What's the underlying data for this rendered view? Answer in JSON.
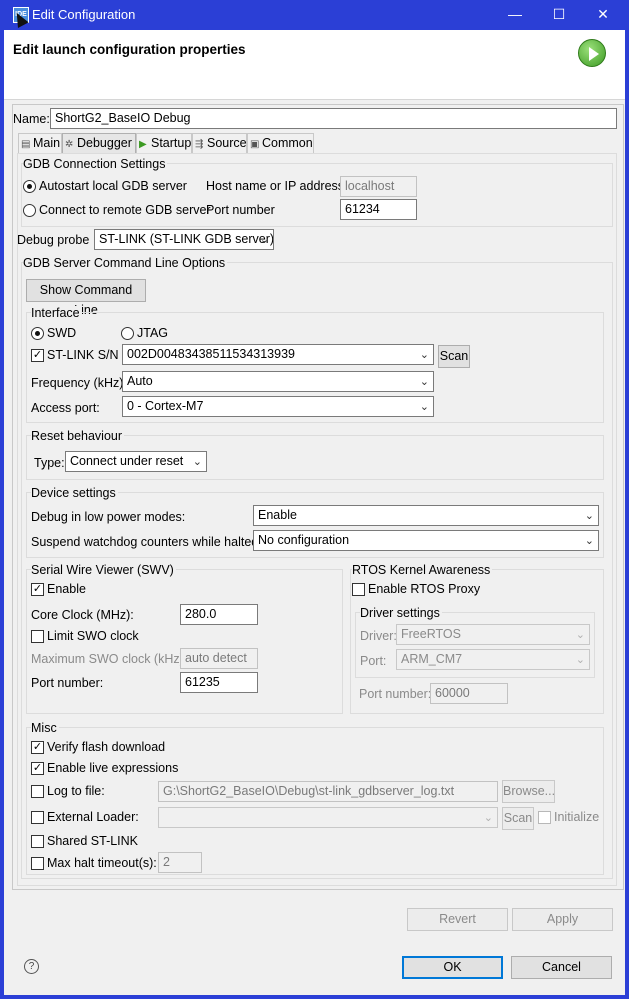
{
  "window": {
    "title": "Edit Configuration",
    "icon_text": "IDE",
    "min": "—",
    "max": "☐",
    "close": "✕"
  },
  "header": {
    "title": "Edit launch configuration properties"
  },
  "name": {
    "label": "Name:",
    "value": "ShortG2_BaseIO Debug"
  },
  "tabs": [
    {
      "label": "Main",
      "icon": "main-tab-icon"
    },
    {
      "label": "Debugger",
      "icon": "debugger-tab-icon"
    },
    {
      "label": "Startup",
      "icon": "startup-tab-icon"
    },
    {
      "label": "Source",
      "icon": "source-tab-icon"
    },
    {
      "label": "Common",
      "icon": "common-tab-icon"
    }
  ],
  "gdb_connection": {
    "title": "GDB Connection Settings",
    "autostart_label": "Autostart local GDB server",
    "remote_label": "Connect to remote GDB server",
    "host_label": "Host name or IP address",
    "host_value": "localhost",
    "port_label": "Port number",
    "port_value": "61234"
  },
  "debug_probe": {
    "label": "Debug probe",
    "value": "ST-LINK (ST-LINK GDB server)"
  },
  "server_options": {
    "title": "GDB Server Command Line Options",
    "show_cmd_label": "Show Command Line"
  },
  "interface": {
    "title": "Interface",
    "swd_label": "SWD",
    "jtag_label": "JTAG",
    "stlink_sn_label": "ST-LINK S/N",
    "stlink_sn_value": "002D00483438511534313939",
    "scan_label": "Scan",
    "freq_label": "Frequency (kHz):",
    "freq_value": "Auto",
    "access_label": "Access port:",
    "access_value": "0 - Cortex-M7"
  },
  "reset": {
    "title": "Reset behaviour",
    "type_label": "Type:",
    "type_value": "Connect under reset"
  },
  "device": {
    "title": "Device settings",
    "low_power_label": "Debug in low power modes:",
    "low_power_value": "Enable",
    "watchdog_label": "Suspend watchdog counters while halted:",
    "watchdog_value": "No configuration"
  },
  "swv": {
    "title": "Serial Wire Viewer (SWV)",
    "enable_label": "Enable",
    "core_clock_label": "Core Clock (MHz):",
    "core_clock_value": "280.0",
    "limit_label": "Limit SWO clock",
    "max_swo_label": "Maximum SWO clock (kHz):",
    "max_swo_value": "auto detect",
    "port_label": "Port number:",
    "port_value": "61235"
  },
  "rtos": {
    "title": "RTOS Kernel Awareness",
    "enable_label": "Enable RTOS Proxy",
    "driver_settings_title": "Driver settings",
    "driver_label": "Driver:",
    "driver_value": "FreeRTOS",
    "port_label": "Port:",
    "port_value": "ARM_CM7",
    "port_number_label": "Port number:",
    "port_number_value": "60000"
  },
  "misc": {
    "title": "Misc",
    "verify_label": "Verify flash download",
    "live_label": "Enable live expressions",
    "log_label": "Log to file:",
    "log_value": "G:\\ShortG2_BaseIO\\Debug\\st-link_gdbserver_log.txt",
    "browse_label": "Browse...",
    "ext_loader_label": "External Loader:",
    "ext_loader_value": "",
    "ext_scan_label": "Scan",
    "initialize_label": "Initialize",
    "shared_label": "Shared ST-LINK",
    "max_halt_label": "Max halt timeout(s):",
    "max_halt_value": "2"
  },
  "buttons": {
    "revert": "Revert",
    "apply": "Apply",
    "ok": "OK",
    "cancel": "Cancel",
    "help": "?"
  },
  "checks": {
    "on": "✓",
    "arrow": "⌄"
  }
}
